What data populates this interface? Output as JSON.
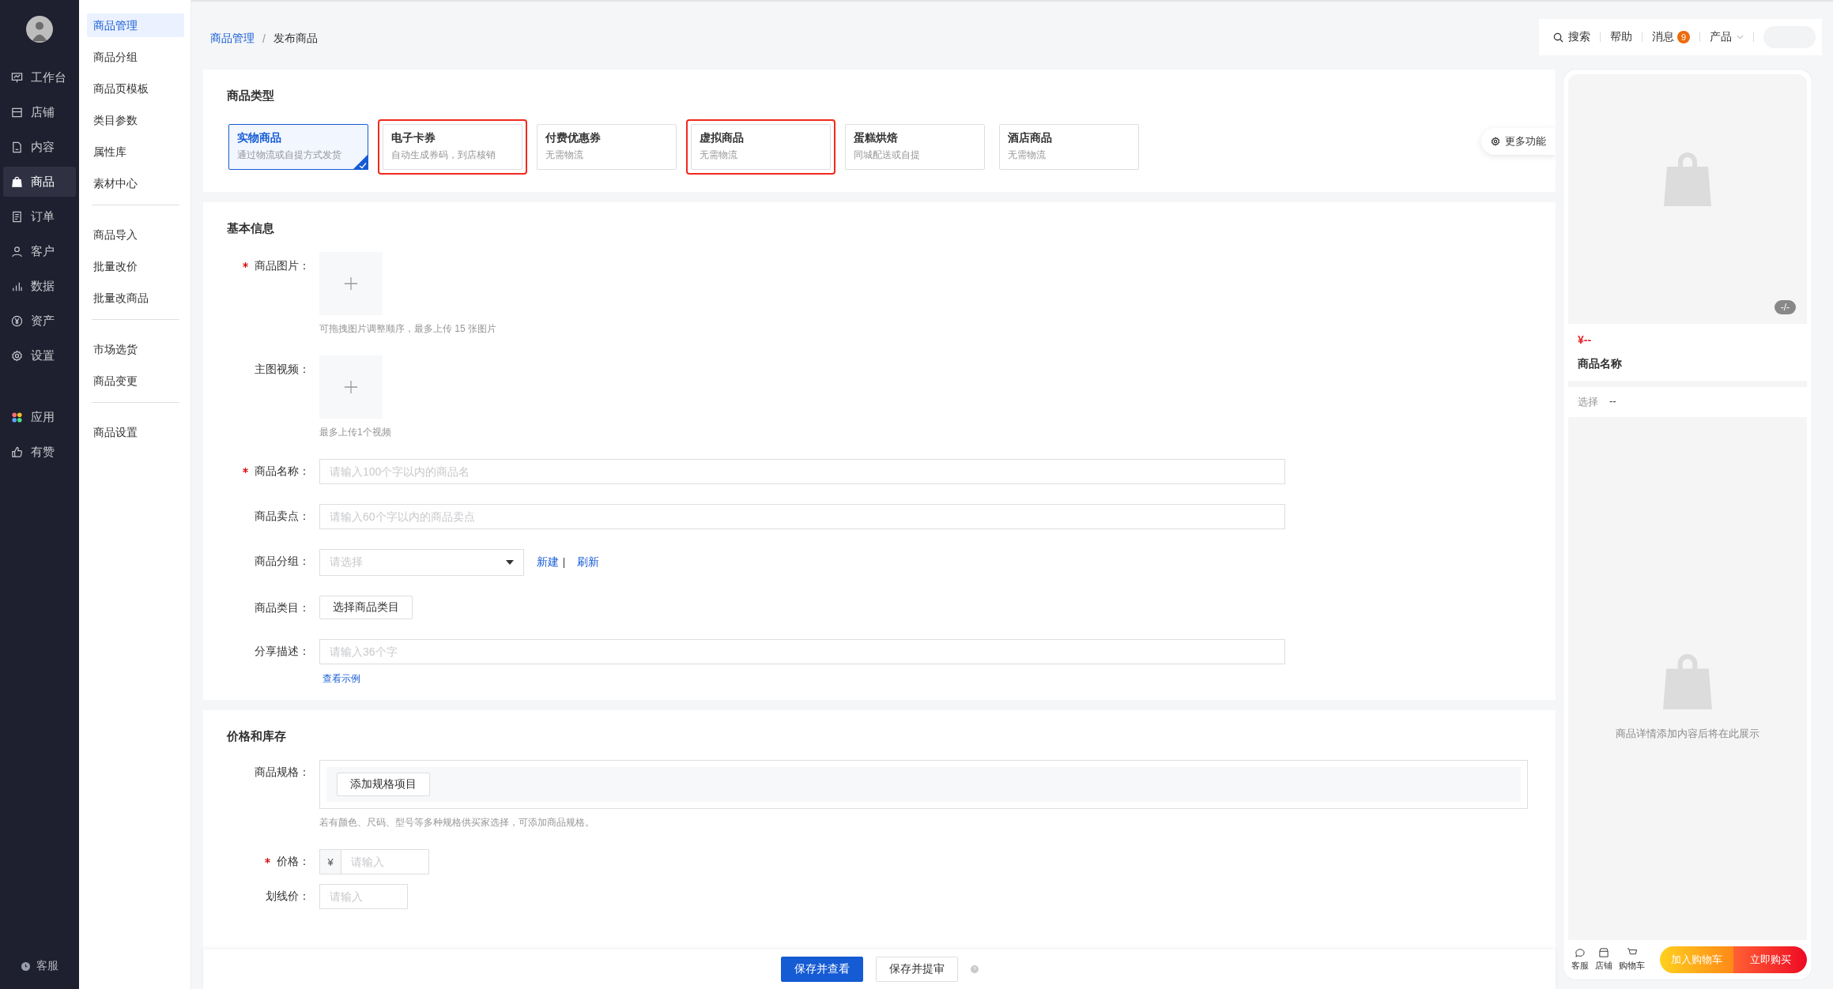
{
  "sidebar": {
    "items": [
      {
        "label": "工作台",
        "selected": false
      },
      {
        "label": "店铺",
        "selected": false
      },
      {
        "label": "内容",
        "selected": false
      },
      {
        "label": "商品",
        "selected": true
      },
      {
        "label": "订单",
        "selected": false
      },
      {
        "label": "客户",
        "selected": false
      },
      {
        "label": "数据",
        "selected": false
      },
      {
        "label": "资产",
        "selected": false
      },
      {
        "label": "设置",
        "selected": false
      }
    ],
    "apps": [
      {
        "label": "应用",
        "selected": false
      },
      {
        "label": "有赞",
        "selected": false
      }
    ],
    "service": "客服"
  },
  "subnav": {
    "groups": [
      [
        {
          "label": "商品管理",
          "selected": true
        },
        {
          "label": "商品分组",
          "selected": false
        },
        {
          "label": "商品页模板",
          "selected": false
        },
        {
          "label": "类目参数",
          "selected": false
        },
        {
          "label": "属性库",
          "selected": false
        },
        {
          "label": "素材中心",
          "selected": false
        }
      ],
      [
        {
          "label": "商品导入",
          "selected": false
        },
        {
          "label": "批量改价",
          "selected": false
        },
        {
          "label": "批量改商品",
          "selected": false
        }
      ],
      [
        {
          "label": "市场选货",
          "selected": false
        },
        {
          "label": "商品变更",
          "selected": false
        }
      ],
      [
        {
          "label": "商品设置",
          "selected": false
        }
      ]
    ]
  },
  "breadcrumb": {
    "items": [
      "商品管理",
      "发布商品"
    ],
    "separator": "/"
  },
  "header": {
    "search": "搜索",
    "help": "帮助",
    "messages": "消息",
    "badge": "9",
    "product": "产品"
  },
  "product_type": {
    "title": "商品类型",
    "more": "更多功能",
    "cards": [
      {
        "name": "实物商品",
        "desc": "通过物流或自提方式发货",
        "selected": true,
        "highlighted": false
      },
      {
        "name": "电子卡券",
        "desc": "自动生成券码，到店核销",
        "selected": false,
        "highlighted": true
      },
      {
        "name": "付费优惠券",
        "desc": "无需物流",
        "selected": false,
        "highlighted": false
      },
      {
        "name": "虚拟商品",
        "desc": "无需物流",
        "selected": false,
        "highlighted": true
      },
      {
        "name": "蛋糕烘焙",
        "desc": "同城配送或自提",
        "selected": false,
        "highlighted": false
      },
      {
        "name": "酒店商品",
        "desc": "无需物流",
        "selected": false,
        "highlighted": false
      }
    ]
  },
  "basic": {
    "title": "基本信息",
    "rows": [
      {
        "kind": "upload",
        "label": "商品图片：",
        "required": true,
        "hint": "可拖拽图片调整顺序，最多上传 15 张图片"
      },
      {
        "kind": "upload",
        "label": "主图视频：",
        "required": false,
        "hint": "最多上传1个视频"
      },
      {
        "kind": "input",
        "label": "商品名称：",
        "required": true,
        "placeholder": "请输入100个字以内的商品名"
      },
      {
        "kind": "input",
        "label": "商品卖点：",
        "required": false,
        "placeholder": "请输入60个字以内的商品卖点"
      },
      {
        "kind": "select",
        "label": "商品分组：",
        "required": false,
        "placeholder": "请选择",
        "links": [
          "新建",
          "刷新"
        ]
      },
      {
        "kind": "button",
        "label": "商品类目：",
        "required": false,
        "button": "选择商品类目"
      },
      {
        "kind": "input",
        "label": "分享描述：",
        "required": false,
        "placeholder": "请输入36个字",
        "link": "查看示例"
      }
    ]
  },
  "price": {
    "title": "价格和库存",
    "spec_label": "商品规格：",
    "spec_button": "添加规格项目",
    "spec_hint": "若有颜色、尺码、型号等多种规格供买家选择，可添加商品规格。",
    "rows": [
      {
        "label": "价格：",
        "required": true,
        "prefix": "¥",
        "placeholder": "请输入"
      },
      {
        "label": "划线价：",
        "required": false,
        "placeholder": "请输入"
      }
    ]
  },
  "preview": {
    "counter": "-/-",
    "price": "¥--",
    "name": "商品名称",
    "select_label": "选择",
    "select_value": "--",
    "detail_hint": "商品详情添加内容后将在此展示",
    "footer": [
      {
        "label": "客服"
      },
      {
        "label": "店铺"
      },
      {
        "label": "购物车"
      }
    ],
    "cart": "加入购物车",
    "buy": "立即购买"
  },
  "actions": [
    {
      "label": "保存并查看",
      "kind": "primary"
    },
    {
      "label": "保存并提审",
      "kind": "default"
    }
  ]
}
